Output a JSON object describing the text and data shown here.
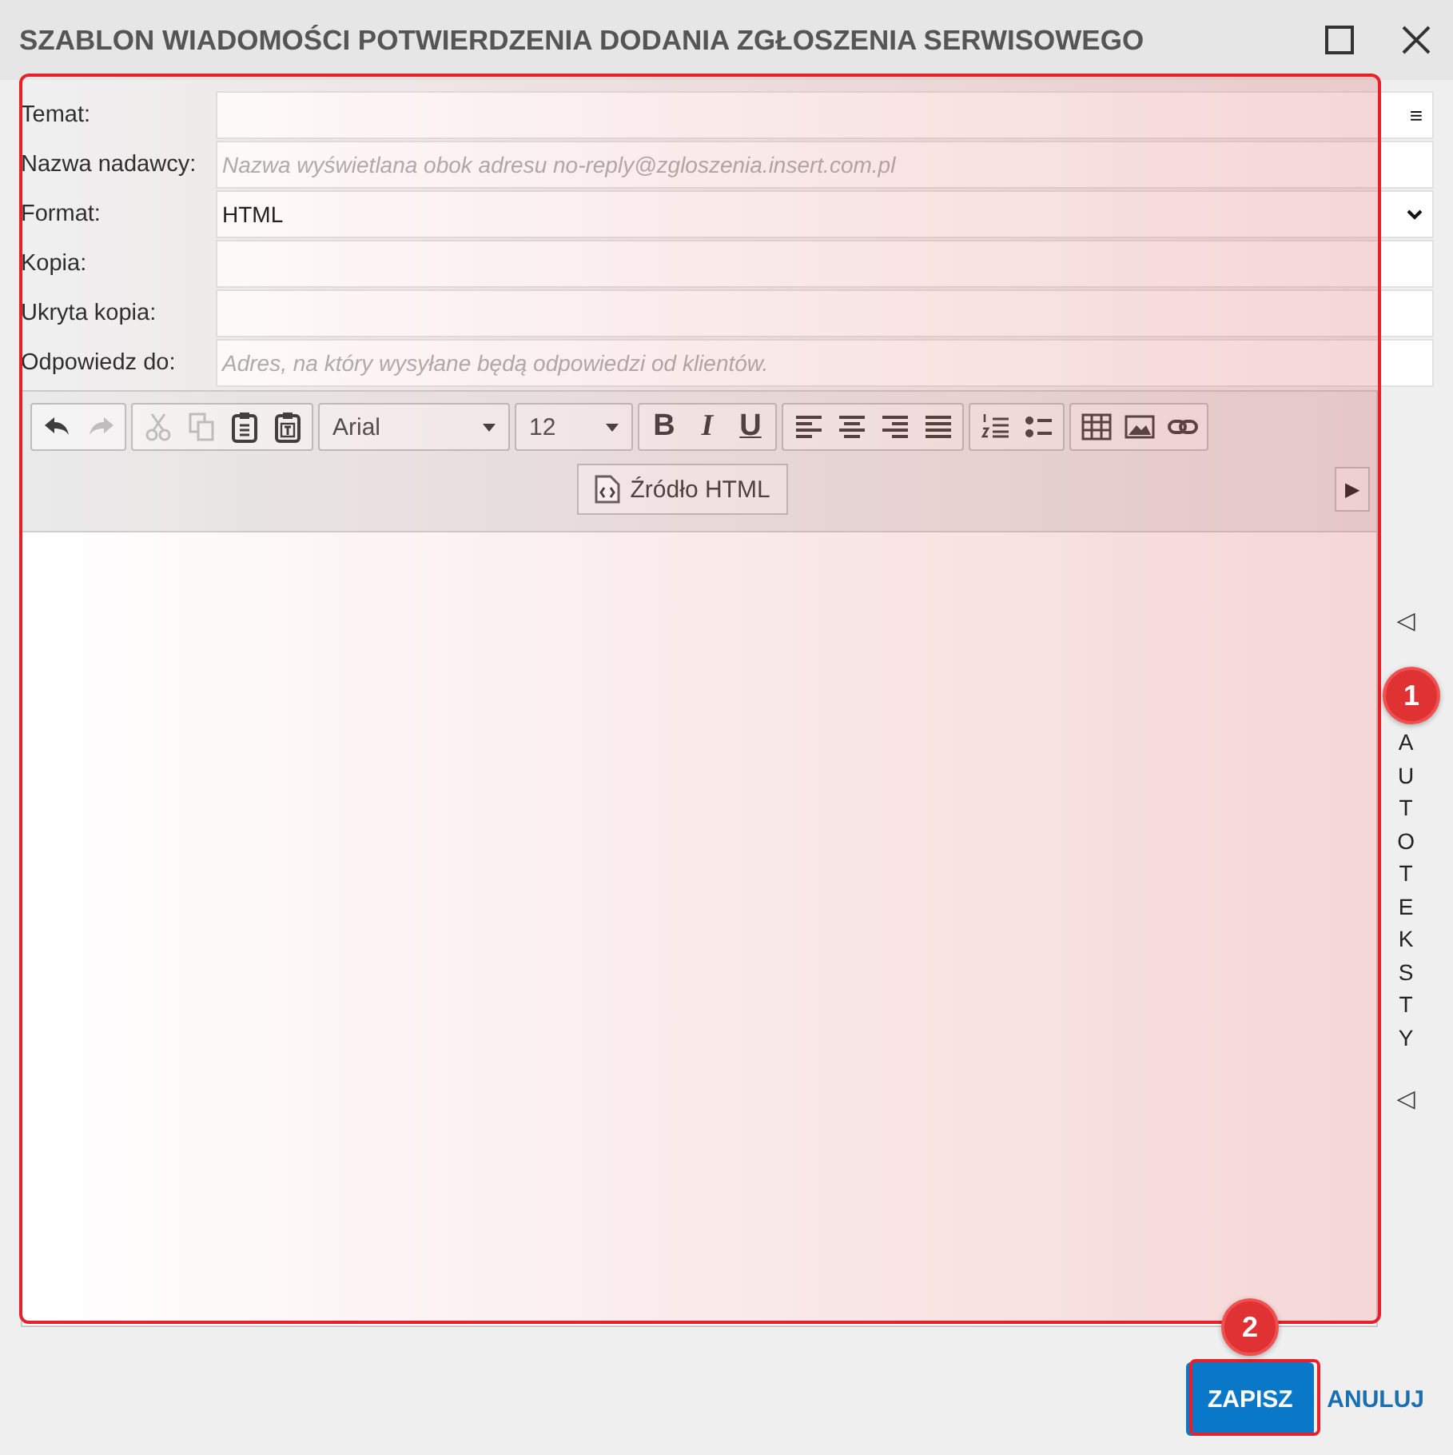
{
  "window": {
    "title": "SZABLON WIADOMOŚCI POTWIERDZENIA DODANIA ZGŁOSZENIA SERWISOWEGO"
  },
  "fields": [
    {
      "label": "Temat:",
      "kind": "menu",
      "menu_glyph": "≡"
    },
    {
      "label": "Nazwa nadawcy:",
      "kind": "text",
      "placeholder": "Nazwa wyświetlana obok adresu no-reply@zgloszenia.insert.com.pl"
    },
    {
      "label": "Format:",
      "kind": "select",
      "value": "HTML"
    },
    {
      "label": "Kopia:",
      "kind": "text"
    },
    {
      "label": "Ukryta kopia:",
      "kind": "text"
    },
    {
      "label": "Odpowiedz do:",
      "kind": "text",
      "placeholder": "Adres, na który wysyłane będą odpowiedzi od klientów."
    }
  ],
  "toolbar": {
    "groups": [
      [
        {
          "kind": "undo",
          "disabled": false
        },
        {
          "kind": "redo",
          "disabled": true
        }
      ],
      [
        {
          "kind": "cut",
          "disabled": true
        },
        {
          "kind": "copy",
          "disabled": true
        },
        {
          "kind": "paste",
          "disabled": false
        },
        {
          "kind": "paste-text",
          "disabled": false
        }
      ],
      [
        {
          "kind": "font",
          "value": "Arial"
        }
      ],
      [
        {
          "kind": "size",
          "value": "12"
        }
      ],
      [
        {
          "kind": "bold",
          "glyph": "B",
          "disabled": false
        },
        {
          "kind": "italic",
          "glyph": "I",
          "disabled": false
        },
        {
          "kind": "underline",
          "glyph": "U",
          "disabled": false
        }
      ],
      [
        {
          "kind": "align-left",
          "disabled": false
        },
        {
          "kind": "align-center",
          "disabled": false
        },
        {
          "kind": "align-right",
          "disabled": false
        },
        {
          "kind": "justify",
          "disabled": false
        }
      ],
      [
        {
          "kind": "numbered-list",
          "disabled": false
        },
        {
          "kind": "bullet-list",
          "disabled": false
        }
      ],
      [
        {
          "kind": "table",
          "disabled": false
        },
        {
          "kind": "image",
          "disabled": false
        },
        {
          "kind": "link",
          "disabled": false
        }
      ]
    ],
    "source_button": "Źródło HTML",
    "more_glyph": "▶"
  },
  "side_panel": {
    "arrow_top": "◁",
    "label": "AUTOTEKSTY",
    "arrow_bottom": "◁"
  },
  "buttons": [
    {
      "label": "ZAPISZ",
      "kind": "primary"
    },
    {
      "label": "ANULUJ",
      "kind": "link"
    }
  ],
  "annotations": [
    {
      "label": "1",
      "kind": "frame"
    },
    {
      "label": "2",
      "kind": "button"
    }
  ]
}
